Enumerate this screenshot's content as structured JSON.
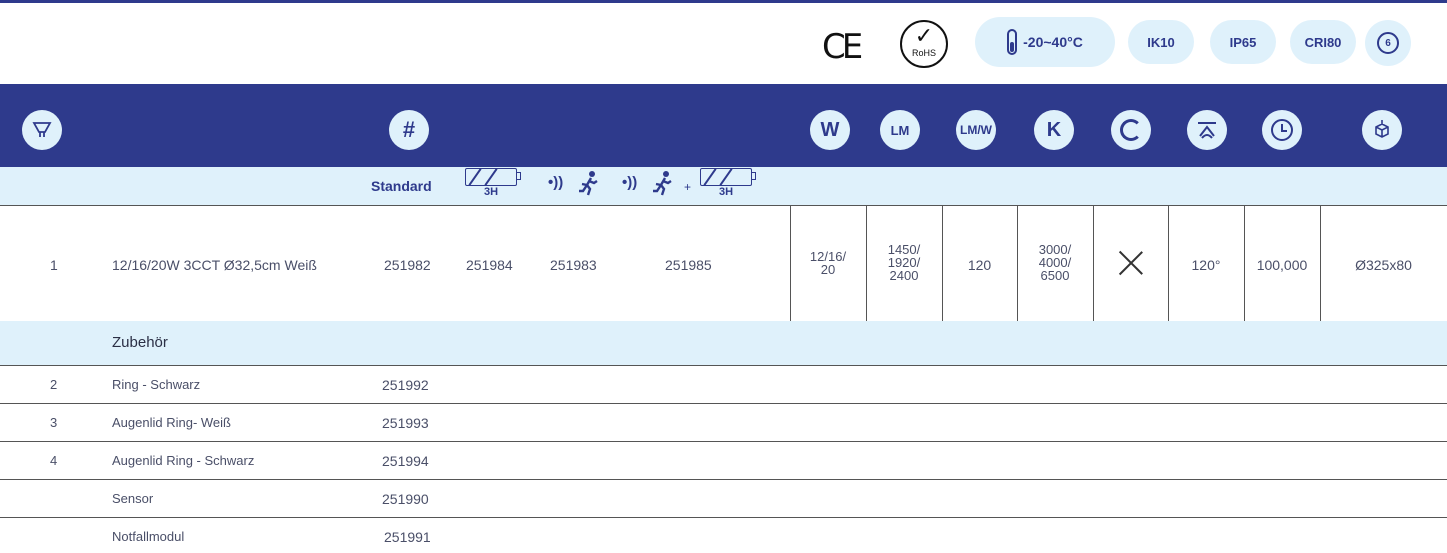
{
  "certifications": {
    "ce": "CE",
    "rohs_check": "✓",
    "rohs_label": "RoHS",
    "temperature": "-20~40°C",
    "ik": "IK10",
    "ip": "IP65",
    "cri": "CRI80",
    "warranty_years": "6"
  },
  "header_icons": {
    "lamp": "lamp-icon",
    "article_number": "#",
    "watt": "W",
    "lumen": "LM",
    "efficacy": "LM/W",
    "kelvin": "K",
    "ring": "ring-icon",
    "beam_angle": "beam-angle-icon",
    "lifetime": "clock-icon",
    "dimensions": "dimensions-icon"
  },
  "subheader": {
    "standard": "Standard",
    "battery_hours_1": "3H",
    "sensor_1": "•))",
    "runner_1": "🏃",
    "sensor_2": "•))",
    "runner_2": "🏃",
    "plus": "+",
    "battery_hours_2": "3H"
  },
  "main_row": {
    "no": "1",
    "description": "12/16/20W 3CCT Ø32,5cm Weiß",
    "art_standard": "251982",
    "art_emergency": "251984",
    "art_sensor": "251983",
    "art_sensor_emergency": "251985",
    "watt_1": "12/16/",
    "watt_2": "20",
    "lumen_1": "1450/",
    "lumen_2": "1920/",
    "lumen_3": "2400",
    "efficacy": "120",
    "kelvin_1": "3000/",
    "kelvin_2": "4000/",
    "kelvin_3": "6500",
    "beam_angle": "120°",
    "lifetime": "100,000",
    "dimensions": "Ø325x80"
  },
  "accessories": {
    "title": "Zubehör",
    "rows": [
      {
        "no": "2",
        "name": "Ring - Schwarz",
        "art": "251992"
      },
      {
        "no": "3",
        "name": "Augenlid Ring- Weiß",
        "art": "251993"
      },
      {
        "no": "4",
        "name": "Augenlid Ring - Schwarz",
        "art": "251994"
      },
      {
        "no": "",
        "name": "Sensor",
        "art": "251990"
      },
      {
        "no": "",
        "name": "Notfallmodul",
        "art": "251991"
      }
    ]
  }
}
